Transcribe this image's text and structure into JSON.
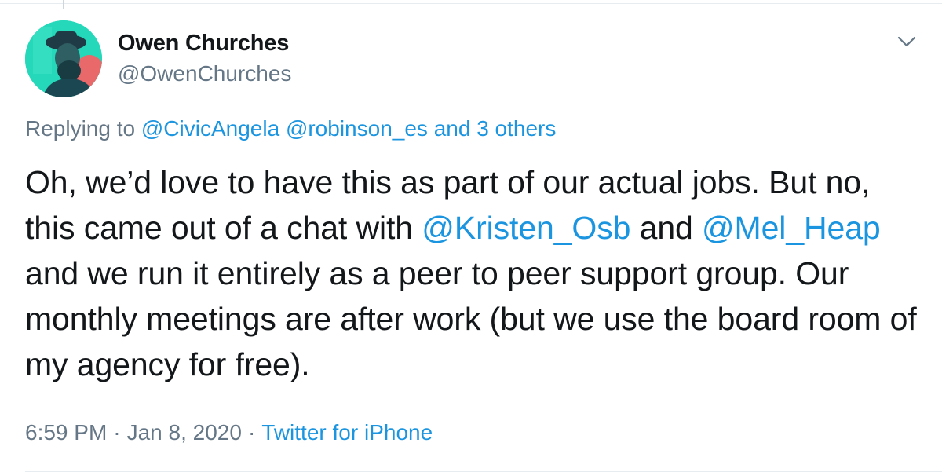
{
  "author": {
    "display_name": "Owen Churches",
    "handle": "@OwenChurches"
  },
  "reply": {
    "prefix": "Replying to",
    "mentions": [
      "@CivicAngela",
      "@robinson_es"
    ],
    "joiner": "and",
    "others": "3 others"
  },
  "tweet": {
    "segments": [
      {
        "text": "Oh, we’d love to have this as part of our actual jobs. But no, this came out of a chat with ",
        "type": "text"
      },
      {
        "text": "@Kristen_Osb",
        "type": "mention"
      },
      {
        "text": " and ",
        "type": "text"
      },
      {
        "text": "@Mel_Heap",
        "type": "mention"
      },
      {
        "text": " and we run it entirely as a peer to peer support group. Our monthly meetings are after work (but we use the board room of my agency for free).",
        "type": "text"
      }
    ]
  },
  "meta": {
    "time": "6:59 PM",
    "date": "Jan 8, 2020",
    "source": "Twitter for iPhone",
    "separator": "·"
  },
  "colors": {
    "link": "#1b95e0",
    "muted": "#657786",
    "text": "#14171a",
    "avatar_bg": "#21d6b7"
  },
  "icons": {
    "more": "chevron-down-icon",
    "avatar": "profile-avatar"
  }
}
